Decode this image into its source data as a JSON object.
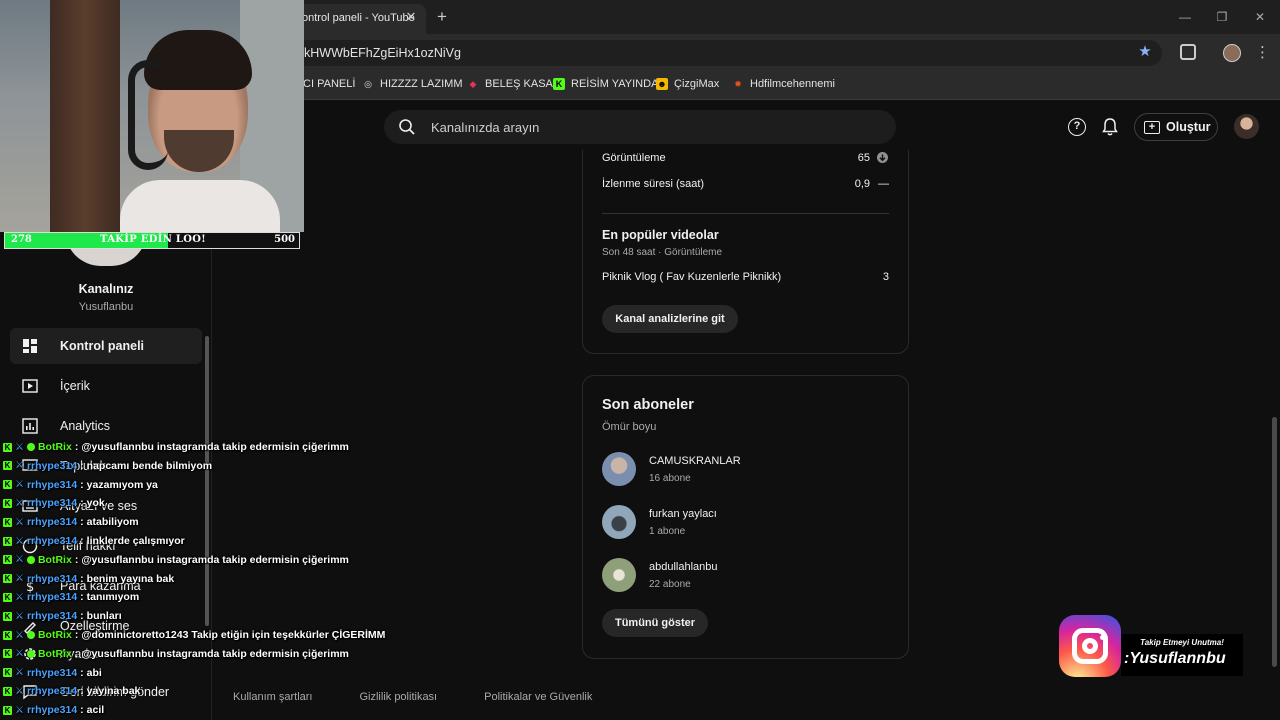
{
  "browser": {
    "tab_title": "ontrol paneli - YouTube",
    "tab_close": "✕",
    "new_tab": "+",
    "url": "kHWWbEFhZgEiHx1ozNiVg",
    "window_controls": {
      "minimize": "—",
      "maximize": "❐",
      "close": "✕"
    },
    "bookmarks": [
      {
        "label": "ICI PANELİ",
        "icon": ""
      },
      {
        "label": "HIZZZZ LAZIMM",
        "icon": "◎",
        "color": "#dddddd"
      },
      {
        "label": "BELEŞ KASA",
        "icon": "◆",
        "color": "#e2335b"
      },
      {
        "label": "REİSİM YAYINDA",
        "icon": "K",
        "color": "#53fc18"
      },
      {
        "label": "ÇizgiMax",
        "icon": "☻",
        "color": "#f5b800"
      },
      {
        "label": "Hdfilmcehennemi",
        "icon": "✹",
        "color": "#e8531c"
      }
    ]
  },
  "header": {
    "search_placeholder": "Kanalınızda arayın",
    "help_glyph": "?",
    "create_label": "Oluştur",
    "create_glyph": "+"
  },
  "sidebar": {
    "channel_name": "Kanalınız",
    "channel_handle": "Yusuflanbu",
    "items": [
      {
        "label": "Kontrol paneli",
        "icon": "dashboard-icon",
        "active": true
      },
      {
        "label": "İçerik",
        "icon": "content-icon"
      },
      {
        "label": "Analytics",
        "icon": "analytics-icon"
      },
      {
        "label": "Topluluk",
        "icon": "community-icon"
      },
      {
        "label": "Altyazı ve ses",
        "icon": "subtitles-icon"
      },
      {
        "label": "Telif hakkı",
        "icon": "copyright-icon"
      },
      {
        "label": "Para kazanma",
        "icon": "monetization-icon"
      },
      {
        "label": "Özelleştirme",
        "icon": "customization-icon"
      },
      {
        "label": "Ayarlar",
        "icon": "settings-icon"
      },
      {
        "label": "Geri bildirim gönder",
        "icon": "feedback-icon"
      }
    ]
  },
  "analytics_card": {
    "metrics": [
      {
        "label": "Görüntüleme",
        "value": "65"
      },
      {
        "label": "İzlenme süresi (saat)",
        "value": "0,9",
        "trend": "—"
      }
    ],
    "popular_title": "En popüler videolar",
    "popular_subtitle": "Son 48 saat · Görüntüleme",
    "popular_video": {
      "title": "Piknik Vlog ( Fav Kuzenlerle Piknikk)",
      "views": "3"
    },
    "button_label": "Kanal analizlerine git"
  },
  "subscribers_card": {
    "title": "Son aboneler",
    "period": "Ömür boyu",
    "subscribers": [
      {
        "name": "CAMUSKRANLAR",
        "count": "16 abone",
        "color": "#7a8fb0"
      },
      {
        "name": "furkan yaylacı",
        "count": "1 abone",
        "color": "#6f8a9a"
      },
      {
        "name": "abdullahlanbu",
        "count": "22 abone",
        "color": "#8ea07a"
      }
    ],
    "button_label": "Tümünü göster"
  },
  "footer": {
    "links": [
      "Kullanım şartları",
      "Gizlilik politikası",
      "Politikalar ve Güvenlik"
    ]
  },
  "stream_overlay": {
    "goal": {
      "current": "278",
      "label": "TAKİP EDİN LOO!",
      "target": "500",
      "progress": 0.556
    },
    "chat": [
      {
        "user": "BotRix",
        "bot": true,
        "message": "@yusuflannbu instagramda takip edermisin çiğerimm"
      },
      {
        "user": "rrhype314",
        "bot": false,
        "message": "napcamı bende bilmiyom"
      },
      {
        "user": "rrhype314",
        "bot": false,
        "message": "yazamıyom ya"
      },
      {
        "user": "rrhype314",
        "bot": false,
        "message": "yok"
      },
      {
        "user": "rrhype314",
        "bot": false,
        "message": "atabiliyom"
      },
      {
        "user": "rrhype314",
        "bot": false,
        "message": "linklerde çalışmıyor"
      },
      {
        "user": "BotRix",
        "bot": true,
        "message": "@yusuflannbu instagramda takip edermisin çiğerimm"
      },
      {
        "user": "rrhype314",
        "bot": false,
        "message": "benim yayına bak"
      },
      {
        "user": "rrhype314",
        "bot": false,
        "message": "tanımıyom"
      },
      {
        "user": "rrhype314",
        "bot": false,
        "message": "bunları"
      },
      {
        "user": "BotRix",
        "bot": true,
        "message": "@dominictoretto1243 Takip etiğin için teşekkürler ÇİGERİMM"
      },
      {
        "user": "BotRix",
        "bot": true,
        "message": "@yusuflannbu instagramda takip edermisin çiğerimm"
      },
      {
        "user": "rrhype314",
        "bot": false,
        "message": "abi"
      },
      {
        "user": "rrhype314",
        "bot": false,
        "message": "yayına bak"
      },
      {
        "user": "rrhype314",
        "bot": false,
        "message": "acil"
      }
    ],
    "instagram": {
      "note": "Takip Etmeyi Unutma!",
      "handle": ":Yusuflannbu"
    }
  }
}
